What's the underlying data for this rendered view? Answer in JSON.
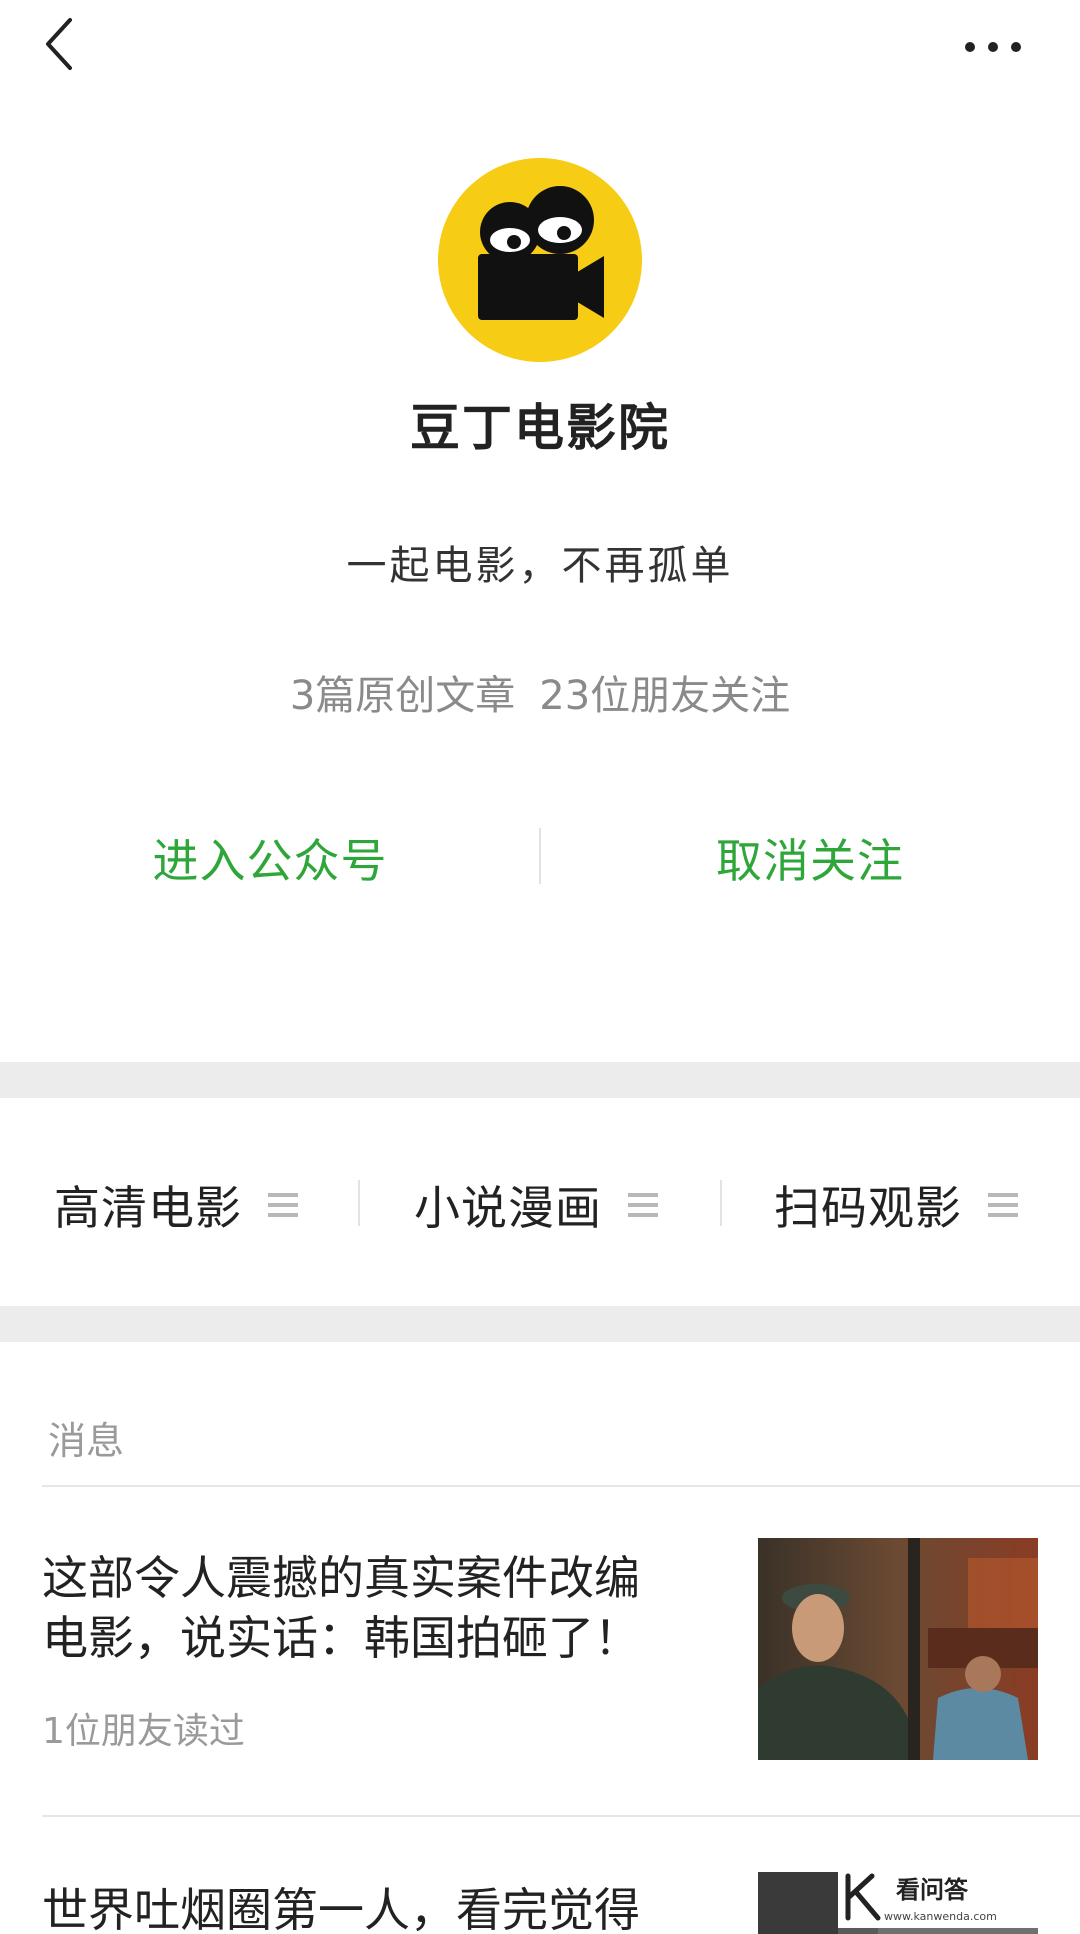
{
  "account": {
    "name": "豆丁电影院",
    "slogan": "一起电影，不再孤单",
    "stats": {
      "articles": "3篇原创文章",
      "followers": "23位朋友关注"
    },
    "avatar_icon": "film-camera-with-eyes-icon",
    "avatar_color": "#f7cc14"
  },
  "actions": {
    "enter_label": "进入公众号",
    "unfollow_label": "取消关注",
    "accent_color": "#2fa63a"
  },
  "menu": [
    {
      "label": "高清电影"
    },
    {
      "label": "小说漫画"
    },
    {
      "label": "扫码观影"
    }
  ],
  "messages": {
    "section_label": "消息",
    "items": [
      {
        "title_line1": "这部令人震撼的真实案件改编",
        "title_line2": "电影，说实话：韩国拍砸了！",
        "meta": "1位朋友读过"
      },
      {
        "title_line1": "世界吐烟圈第一人，看完觉得"
      }
    ]
  },
  "watermark": {
    "name": "看问答",
    "url": "www.kanwenda.com"
  }
}
